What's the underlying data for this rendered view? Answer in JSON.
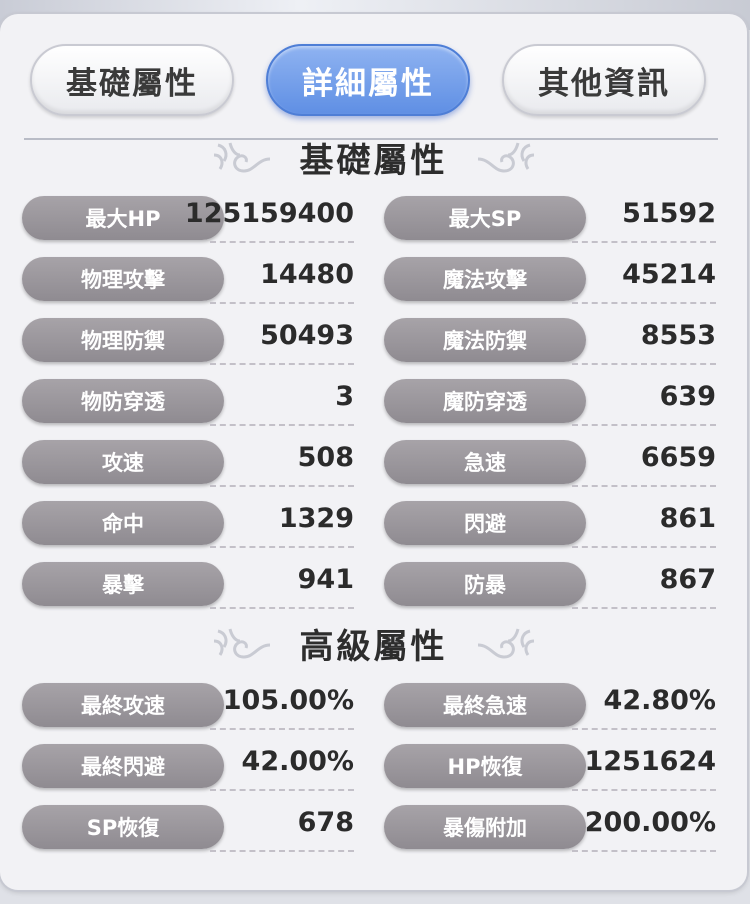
{
  "tabs": [
    {
      "label": "基礎屬性",
      "active": false
    },
    {
      "label": "詳細屬性",
      "active": true
    },
    {
      "label": "其他資訊",
      "active": false
    }
  ],
  "sections": {
    "basic": {
      "title": "基礎屬性",
      "rows": [
        {
          "left": {
            "label": "最大HP",
            "value": "125159400"
          },
          "right": {
            "label": "最大SP",
            "value": "51592"
          }
        },
        {
          "left": {
            "label": "物理攻擊",
            "value": "14480"
          },
          "right": {
            "label": "魔法攻擊",
            "value": "45214"
          }
        },
        {
          "left": {
            "label": "物理防禦",
            "value": "50493"
          },
          "right": {
            "label": "魔法防禦",
            "value": "8553"
          }
        },
        {
          "left": {
            "label": "物防穿透",
            "value": "3"
          },
          "right": {
            "label": "魔防穿透",
            "value": "639"
          }
        },
        {
          "left": {
            "label": "攻速",
            "value": "508"
          },
          "right": {
            "label": "急速",
            "value": "6659"
          }
        },
        {
          "left": {
            "label": "命中",
            "value": "1329"
          },
          "right": {
            "label": "閃避",
            "value": "861"
          }
        },
        {
          "left": {
            "label": "暴擊",
            "value": "941"
          },
          "right": {
            "label": "防暴",
            "value": "867"
          }
        }
      ]
    },
    "advanced": {
      "title": "高級屬性",
      "rows": [
        {
          "left": {
            "label": "最終攻速",
            "value": "105.00%"
          },
          "right": {
            "label": "最終急速",
            "value": "42.80%"
          }
        },
        {
          "left": {
            "label": "最終閃避",
            "value": "42.00%"
          },
          "right": {
            "label": "HP恢復",
            "value": "1251624"
          }
        },
        {
          "left": {
            "label": "SP恢復",
            "value": "678"
          },
          "right": {
            "label": "暴傷附加",
            "value": "200.00%"
          }
        }
      ]
    }
  },
  "colors": {
    "active_tab": "#6b98e8",
    "label_pill": "#9b979d",
    "value_text": "#2b2b2b"
  },
  "icons": {
    "title_ornament": "flourish-icon"
  }
}
